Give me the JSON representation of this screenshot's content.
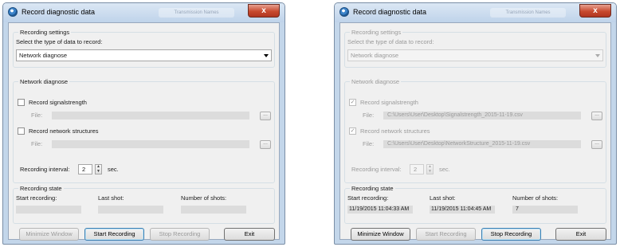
{
  "windows": [
    {
      "title": "Record diagnostic data",
      "ghost_tab": "Transmission Names",
      "close_label": "x",
      "recording_settings": {
        "group_title": "Recording settings",
        "select_label": "Select the type of data to record:",
        "selected_type": "Network diagnose"
      },
      "network_diagnose": {
        "group_title": "Network diagnose",
        "signalstrength_label": "Record signalstrength",
        "signalstrength_checked": "",
        "signalstrength_file_label": "File:",
        "signalstrength_file": "",
        "structures_label": "Record network structures",
        "structures_checked": "",
        "structures_file_label": "File:",
        "structures_file": "",
        "browse_label": "...",
        "interval_label": "Recording interval:",
        "interval_value": "2",
        "interval_unit": "sec."
      },
      "recording_state": {
        "group_title": "Recording state",
        "start_label": "Start recording:",
        "start_value": "",
        "last_label": "Last shot:",
        "last_value": "",
        "shots_label": "Number of shots:",
        "shots_value": ""
      },
      "buttons": {
        "minimize": "Minimize Window",
        "start": "Start Recording",
        "stop": "Stop Recording",
        "exit": "Exit"
      }
    },
    {
      "title": "Record diagnostic data",
      "ghost_tab": "Transmission Names",
      "close_label": "x",
      "recording_settings": {
        "group_title": "Recording settings",
        "select_label": "Select the type of data to record:",
        "selected_type": "Network diagnose"
      },
      "network_diagnose": {
        "group_title": "Network diagnose",
        "signalstrength_label": "Record signalstrength",
        "signalstrength_checked": "✓",
        "signalstrength_file_label": "File:",
        "signalstrength_file": "C:\\Users\\User\\Desktop\\Signalstrength_2015-11-19.csv",
        "structures_label": "Record network structures",
        "structures_checked": "✓",
        "structures_file_label": "File:",
        "structures_file": "C:\\Users\\User\\Desktop\\NetworkStructure_2015-11-19.csv",
        "browse_label": "...",
        "interval_label": "Recording interval:",
        "interval_value": "2",
        "interval_unit": "sec."
      },
      "recording_state": {
        "group_title": "Recording state",
        "start_label": "Start recording:",
        "start_value": "11/19/2015 11:04:33 AM",
        "last_label": "Last shot:",
        "last_value": "11/19/2015 11:04:45 AM",
        "shots_label": "Number of shots:",
        "shots_value": "7"
      },
      "buttons": {
        "minimize": "Minimize Window",
        "start": "Start Recording",
        "stop": "Stop Recording",
        "exit": "Exit"
      }
    }
  ]
}
